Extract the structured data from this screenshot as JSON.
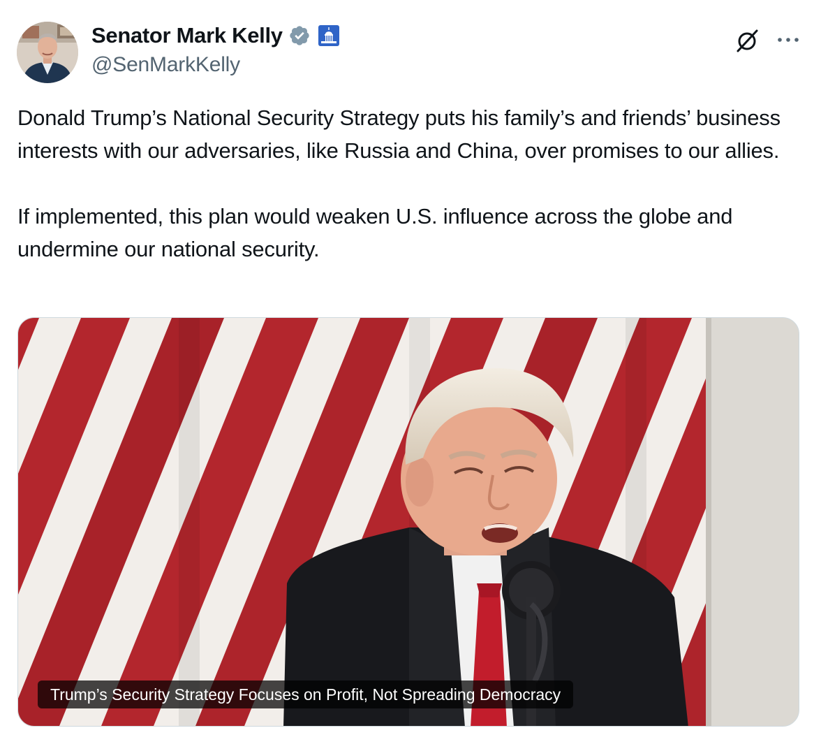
{
  "author": {
    "display_name": "Senator Mark Kelly",
    "handle": "@SenMarkKelly",
    "verified_badge_color": "#829aab"
  },
  "icons": {
    "verified": "verified-badge-icon",
    "government": "capitol-building-icon",
    "grok": "grok-icon",
    "more": "more-options-icon"
  },
  "tweet": {
    "paragraphs": [
      "Donald Trump’s National Security Strategy puts his family’s and friends’ business interests with our adversaries, like Russia and China, over promises to our allies.",
      "If implemented, this plan would weaken U.S. influence across the globe and undermine our national security."
    ]
  },
  "media": {
    "caption": "Trump’s Security Strategy Focuses on Profit, Not Spreading Democracy"
  },
  "colors": {
    "text": "#0f1419",
    "secondary": "#536471",
    "border": "#cfd9de",
    "flag_red": "#b3262d",
    "flag_white": "#f2eeea"
  }
}
